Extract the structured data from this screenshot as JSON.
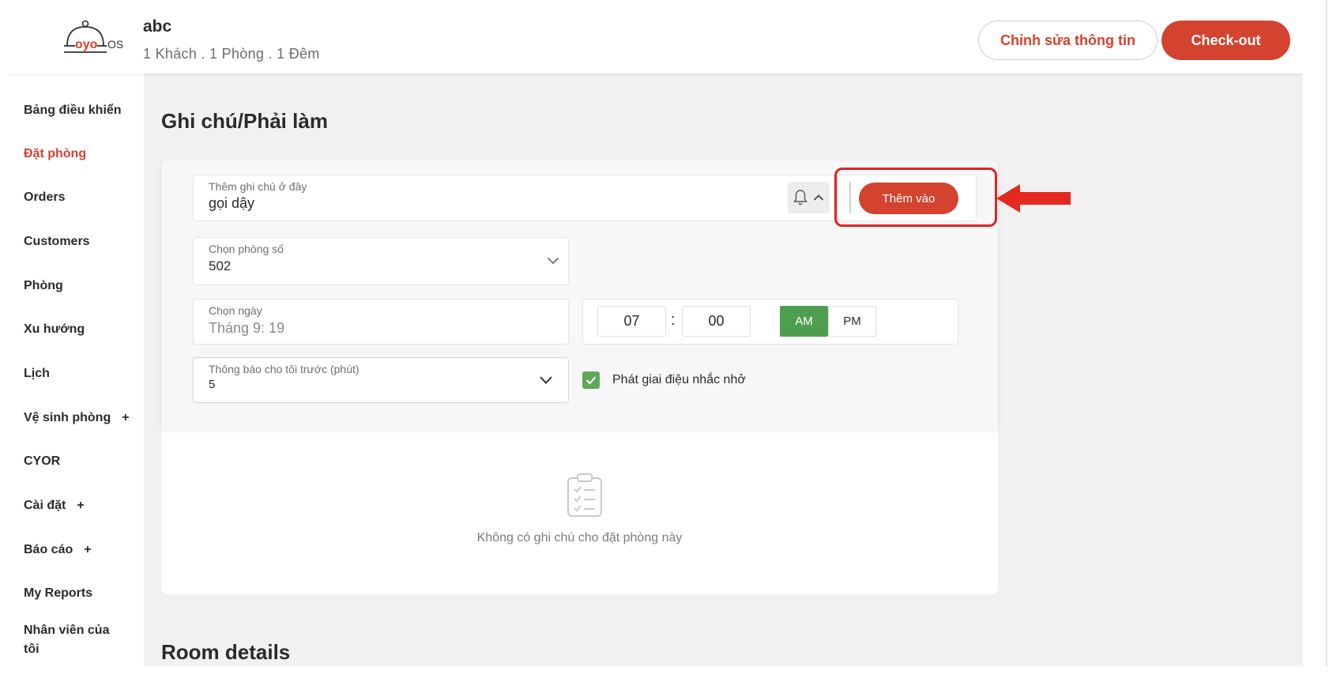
{
  "header": {
    "logo_text": "OYO OS",
    "guest_name": "abc",
    "guest_meta": "1 Khách . 1 Phòng . 1 Đêm",
    "edit_label": "Chỉnh sửa thông tin",
    "checkout_label": "Check-out"
  },
  "sidebar": {
    "items": [
      {
        "label": "Bảng điều khiển",
        "active": false,
        "expandable": false
      },
      {
        "label": "Đặt phòng",
        "active": true,
        "expandable": false
      },
      {
        "label": "Orders",
        "active": false,
        "expandable": false
      },
      {
        "label": "Customers",
        "active": false,
        "expandable": false
      },
      {
        "label": "Phòng",
        "active": false,
        "expandable": false
      },
      {
        "label": "Xu hướng",
        "active": false,
        "expandable": false
      },
      {
        "label": "Lịch",
        "active": false,
        "expandable": false
      },
      {
        "label": "Vệ sinh phòng",
        "active": false,
        "expandable": true
      },
      {
        "label": "CYOR",
        "active": false,
        "expandable": false
      },
      {
        "label": "Cài đặt",
        "active": false,
        "expandable": true
      },
      {
        "label": "Báo cáo",
        "active": false,
        "expandable": true
      },
      {
        "label": "My Reports",
        "active": false,
        "expandable": false
      },
      {
        "label": "Nhân viên của tôi",
        "active": false,
        "expandable": false
      }
    ],
    "plus_symbol": "+"
  },
  "notes": {
    "title": "Ghi chú/Phải làm",
    "note_input": {
      "label": "Thêm ghi chú ở đây",
      "value": "gọi dậy"
    },
    "add_button": "Thêm vào",
    "room_select": {
      "label": "Chọn phòng số",
      "value": "502"
    },
    "date_field": {
      "label": "Chọn ngày",
      "value": "Tháng 9: 19"
    },
    "time": {
      "hour": "07",
      "separator": ":",
      "minute": "00",
      "am": "AM",
      "pm": "PM",
      "selected": "AM"
    },
    "notify_select": {
      "label": "Thông báo cho tôi trước (phút)",
      "value": "5"
    },
    "play_tone": {
      "label": "Phát giai điệu nhắc nhở",
      "checked": true
    },
    "empty_text": "Không có ghi chú cho đặt phòng này"
  },
  "room_details": {
    "title": "Room details"
  },
  "colors": {
    "brand_red": "#d4432f",
    "active_green": "#4f9e4f",
    "highlight_red": "#e02424"
  }
}
